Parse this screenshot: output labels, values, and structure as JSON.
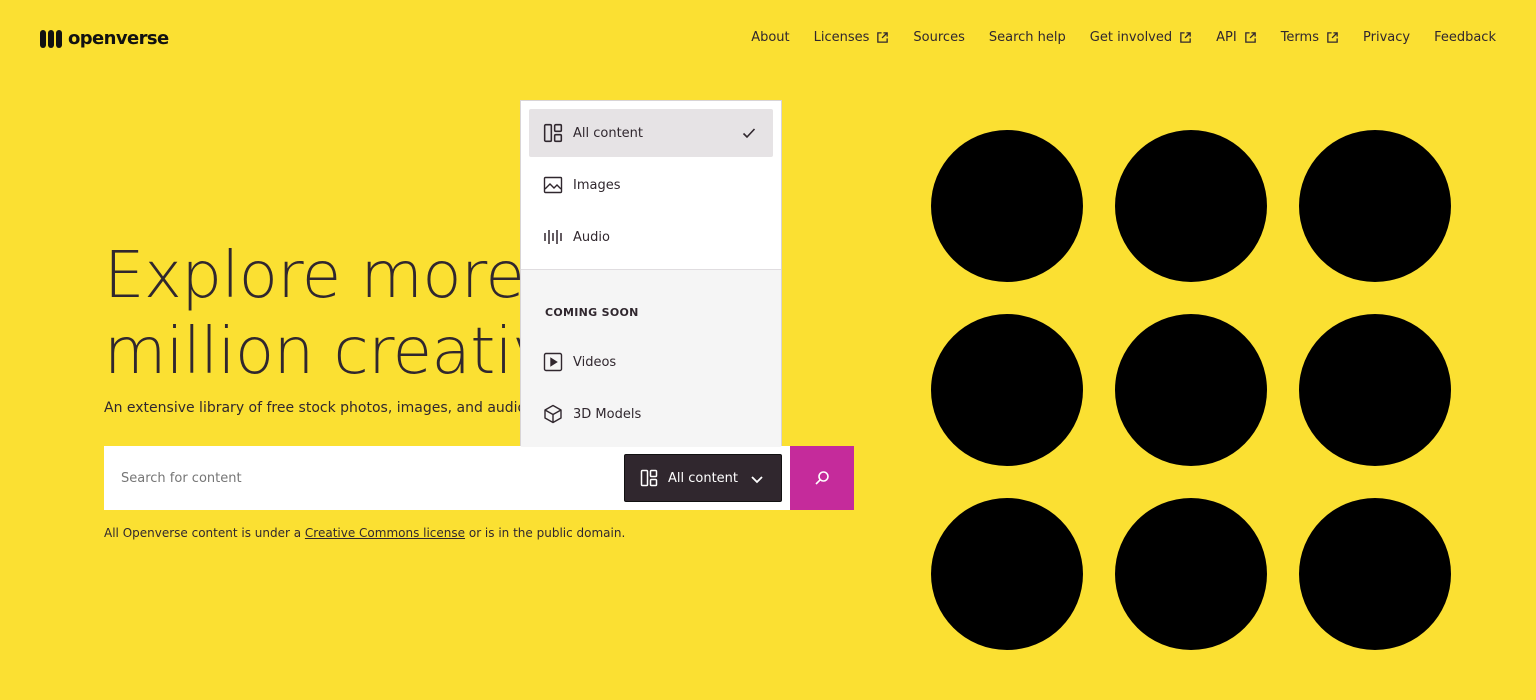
{
  "header": {
    "logo_text": "openverse",
    "nav": [
      {
        "label": "About",
        "external": false
      },
      {
        "label": "Licenses",
        "external": true
      },
      {
        "label": "Sources",
        "external": false
      },
      {
        "label": "Search help",
        "external": false
      },
      {
        "label": "Get involved",
        "external": true
      },
      {
        "label": "API",
        "external": true
      },
      {
        "label": "Terms",
        "external": true
      },
      {
        "label": "Privacy",
        "external": false
      },
      {
        "label": "Feedback",
        "external": false
      }
    ]
  },
  "hero": {
    "title_line1": "Explore more t",
    "title_line2": "million creative",
    "subtitle": "An extensive library of free stock photos, images, and audio, a"
  },
  "search": {
    "placeholder": "Search for content",
    "type_button_label": "All content",
    "submit_icon": "search-icon"
  },
  "license_note": {
    "prefix": "All Openverse content is under a ",
    "link": "Creative Commons license",
    "suffix": " or is in the public domain."
  },
  "dropdown": {
    "items": [
      {
        "label": "All content",
        "icon": "all-content-icon",
        "selected": true
      },
      {
        "label": "Images",
        "icon": "image-icon",
        "selected": false
      },
      {
        "label": "Audio",
        "icon": "audio-icon",
        "selected": false
      }
    ],
    "coming_soon_label": "COMING SOON",
    "coming_soon_items": [
      {
        "label": "Videos",
        "icon": "video-icon"
      },
      {
        "label": "3D Models",
        "icon": "cube-icon"
      }
    ]
  },
  "colors": {
    "background": "#fbe032",
    "search_submit": "#c52b9b",
    "text": "#30272e"
  }
}
